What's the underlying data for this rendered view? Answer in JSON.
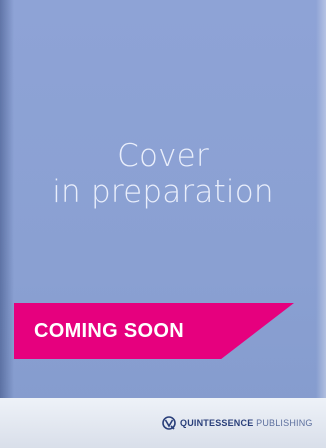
{
  "cover": {
    "placeholder_line1": "Cover",
    "placeholder_line2": "in preparation"
  },
  "banner": {
    "label": "COMING SOON",
    "color": "#e6007e"
  },
  "publisher": {
    "name_bold": "QUINTESSENCE",
    "name_light": " PUBLISHING",
    "logo_icon": "quintessence-logo-icon"
  },
  "colors": {
    "cover_background": "#8ea3d6",
    "footer_background": "#e6eaf2"
  }
}
